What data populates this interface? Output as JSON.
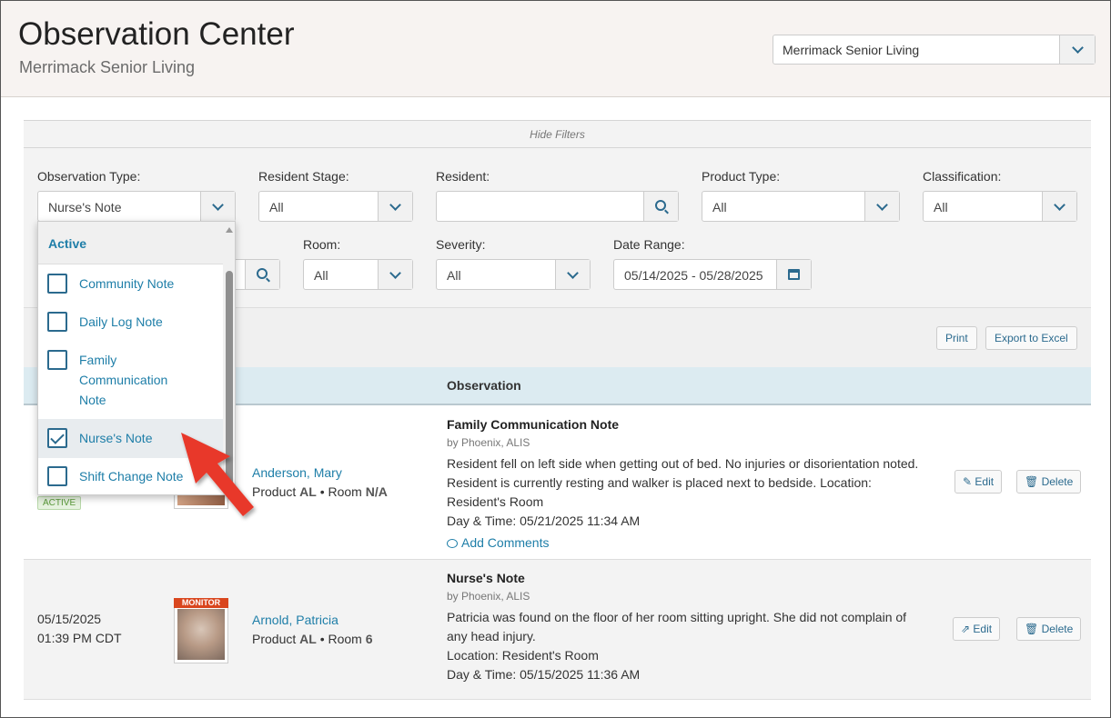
{
  "header": {
    "title": "Observation Center",
    "subtitle": "Merrimack Senior Living",
    "facility_select": "Merrimack Senior Living"
  },
  "filters": {
    "toggle_label": "Hide Filters",
    "observation_type": {
      "label": "Observation Type:",
      "value": "Nurse's Note"
    },
    "resident_stage": {
      "label": "Resident Stage:",
      "value": "All"
    },
    "resident": {
      "label": "Resident:",
      "value": ""
    },
    "product_type": {
      "label": "Product Type:",
      "value": "All"
    },
    "classification": {
      "label": "Classification:",
      "value": "All"
    },
    "room": {
      "label": "Room:",
      "value": "All"
    },
    "severity": {
      "label": "Severity:",
      "value": "All"
    },
    "date_range": {
      "label": "Date Range:",
      "value": "05/14/2025 - 05/28/2025"
    }
  },
  "dropdown": {
    "group": "Active",
    "items": [
      {
        "label": "Community Note",
        "checked": false
      },
      {
        "label": "Daily Log Note",
        "checked": false
      },
      {
        "label": "Family Communication Note",
        "checked": false
      },
      {
        "label": "Nurse's Note",
        "checked": true
      },
      {
        "label": "Shift Change Note",
        "checked": false
      }
    ]
  },
  "toolbar": {
    "print": "Print",
    "export": "Export to Excel"
  },
  "table": {
    "header_observation": "Observation",
    "rows": [
      {
        "status": "ACTIVE",
        "resident": "Anderson, Mary",
        "product": "AL",
        "room": "N/A",
        "product_prefix": "Product",
        "room_prefix": "• Room",
        "obs_title": "Family Communication Note",
        "obs_by": "by Phoenix, ALIS",
        "obs_lines": [
          "Resident fell on left side when getting out of bed. No injuries or disorientation noted.",
          "Resident is currently resting and walker is placed next to bedside. Location:",
          "Resident's Room",
          "Day & Time: 05/21/2025 11:34 AM"
        ],
        "add_comments": "Add Comments",
        "edit": "Edit",
        "delete": "Delete"
      },
      {
        "date": "05/15/2025",
        "time": "01:39 PM CDT",
        "tag": "MONITOR",
        "resident": "Arnold, Patricia",
        "product": "AL",
        "room": "6",
        "product_prefix": "Product",
        "room_prefix": "• Room",
        "obs_title": "Nurse's Note",
        "obs_by": "by Phoenix, ALIS",
        "obs_lines": [
          "Patricia was found on the floor of her room sitting upright.  She did not complain of",
          "any head injury.",
          "Location: Resident's Room",
          "Day & Time: 05/15/2025 11:36 AM"
        ],
        "edit": "Edit",
        "delete": "Delete"
      }
    ]
  },
  "colors": {
    "accent": "#1e7ea8",
    "header_bg": "#f7f3f1",
    "table_header_bg": "#dcebf1",
    "monitor_tag": "#d9461e",
    "arrow": "#e8392b"
  }
}
